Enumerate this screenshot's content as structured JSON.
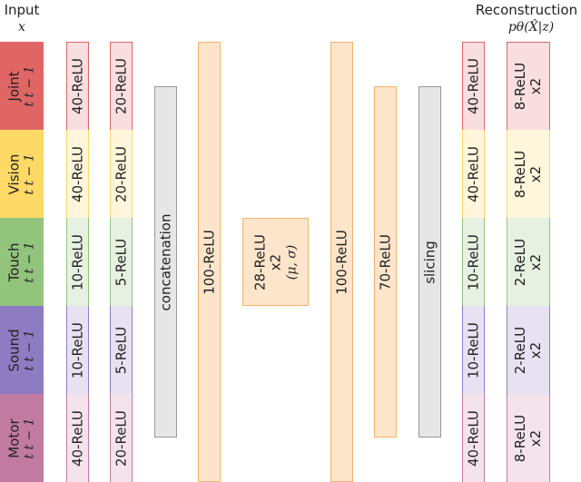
{
  "header": {
    "input_title": "Input",
    "input_symbol": "x",
    "output_title": "Reconstruction",
    "output_symbol": "pθ(X̂|z)"
  },
  "colors": {
    "joint": "#e06666",
    "vision": "#ffd966",
    "touch": "#93c47d",
    "sound": "#8e7cc3",
    "motor": "#c27ba0",
    "joint_light": "#f8dede",
    "vision_light": "#fff6dc",
    "touch_light": "#e6f1e1",
    "sound_light": "#e6e2f1",
    "motor_light": "#f4e3ec",
    "hidden_fill": "#fde5cc",
    "hidden_border": "#f6b26b",
    "gray_fill": "#e6e6e6",
    "gray_border": "#999999"
  },
  "modalities": [
    {
      "name": "Joint",
      "time": "t  t − 1",
      "enc1": "40-ReLU",
      "enc2": "20-ReLU",
      "dec1": "40-ReLU",
      "dec2": "8-ReLU",
      "dec2_mult": "x2"
    },
    {
      "name": "Vision",
      "time": "t  t − 1",
      "enc1": "40-ReLU",
      "enc2": "20-ReLU",
      "dec1": "40-ReLU",
      "dec2": "8-ReLU",
      "dec2_mult": "x2"
    },
    {
      "name": "Touch",
      "time": "t  t − 1",
      "enc1": "10-ReLU",
      "enc2": "5-ReLU",
      "dec1": "10-ReLU",
      "dec2": "2-ReLU",
      "dec2_mult": "x2"
    },
    {
      "name": "Sound",
      "time": "t  t − 1",
      "enc1": "10-ReLU",
      "enc2": "5-ReLU",
      "dec1": "10-ReLU",
      "dec2": "2-ReLU",
      "dec2_mult": "x2"
    },
    {
      "name": "Motor",
      "time": "t  t − 1",
      "enc1": "40-ReLU",
      "enc2": "20-ReLU",
      "dec1": "40-ReLU",
      "dec2": "8-ReLU",
      "dec2_mult": "x2"
    }
  ],
  "layers": {
    "concat": "concatenation",
    "enc_hidden": "100-ReLU",
    "latent_line1": "28-ReLU",
    "latent_line2": "x2",
    "latent_line3": "(μ, σ)",
    "dec_hidden1": "100-ReLU",
    "dec_hidden2": "70-ReLU",
    "slicing": "slicing"
  }
}
